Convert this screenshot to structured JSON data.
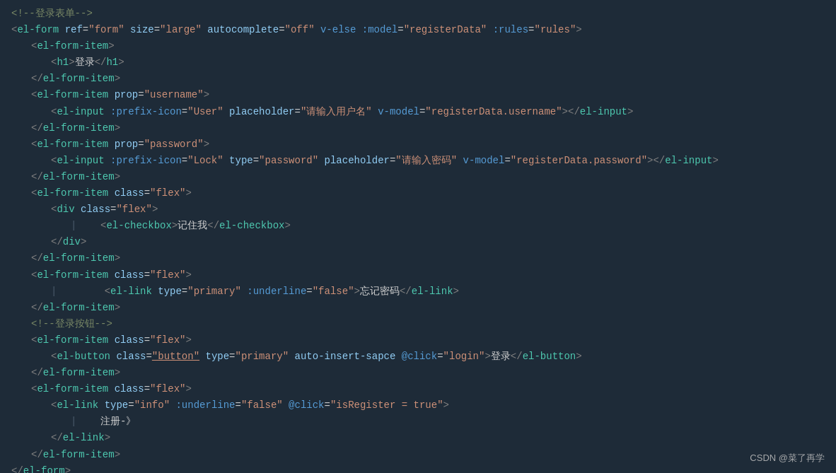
{
  "watermark": "CSDN @菜了再学",
  "lines": [
    {
      "indent": 0,
      "tokens": [
        {
          "t": "comment",
          "v": "<!--登录表单-->"
        }
      ]
    },
    {
      "indent": 0,
      "tokens": [
        {
          "t": "punct",
          "v": "<"
        },
        {
          "t": "tag",
          "v": "el-form"
        },
        {
          "t": "text",
          "v": " "
        },
        {
          "t": "attr",
          "v": "ref"
        },
        {
          "t": "eq",
          "v": "="
        },
        {
          "t": "str",
          "v": "\"form\""
        },
        {
          "t": "text",
          "v": " "
        },
        {
          "t": "attr",
          "v": "size"
        },
        {
          "t": "eq",
          "v": "="
        },
        {
          "t": "str",
          "v": "\"large\""
        },
        {
          "t": "text",
          "v": " "
        },
        {
          "t": "attr",
          "v": "autocomplete"
        },
        {
          "t": "eq",
          "v": "="
        },
        {
          "t": "str",
          "v": "\"off\""
        },
        {
          "t": "text",
          "v": " "
        },
        {
          "t": "bind",
          "v": "v-else"
        },
        {
          "t": "text",
          "v": " "
        },
        {
          "t": "bind",
          "v": ":model"
        },
        {
          "t": "eq",
          "v": "="
        },
        {
          "t": "str",
          "v": "\"registerData\""
        },
        {
          "t": "text",
          "v": " "
        },
        {
          "t": "bind",
          "v": ":rules"
        },
        {
          "t": "eq",
          "v": "="
        },
        {
          "t": "str",
          "v": "\"rules\""
        },
        {
          "t": "punct",
          "v": ">"
        }
      ]
    },
    {
      "indent": 1,
      "tokens": [
        {
          "t": "punct",
          "v": "<"
        },
        {
          "t": "tag",
          "v": "el-form-item"
        },
        {
          "t": "punct",
          "v": ">"
        }
      ]
    },
    {
      "indent": 2,
      "tokens": [
        {
          "t": "punct",
          "v": "<"
        },
        {
          "t": "tag",
          "v": "h1"
        },
        {
          "t": "punct",
          "v": ">"
        },
        {
          "t": "text-cn",
          "v": "登录"
        },
        {
          "t": "punct",
          "v": "</"
        },
        {
          "t": "tag",
          "v": "h1"
        },
        {
          "t": "punct",
          "v": ">"
        }
      ]
    },
    {
      "indent": 1,
      "tokens": [
        {
          "t": "punct",
          "v": "</"
        },
        {
          "t": "tag",
          "v": "el-form-item"
        },
        {
          "t": "punct",
          "v": ">"
        }
      ]
    },
    {
      "indent": 1,
      "tokens": [
        {
          "t": "punct",
          "v": "<"
        },
        {
          "t": "tag",
          "v": "el-form-item"
        },
        {
          "t": "text",
          "v": " "
        },
        {
          "t": "attr",
          "v": "prop"
        },
        {
          "t": "eq",
          "v": "="
        },
        {
          "t": "str-username",
          "v": "\"username\""
        },
        {
          "t": "punct",
          "v": ">"
        }
      ]
    },
    {
      "indent": 2,
      "tokens": [
        {
          "t": "punct",
          "v": "<"
        },
        {
          "t": "tag",
          "v": "el-input"
        },
        {
          "t": "text",
          "v": " "
        },
        {
          "t": "bind",
          "v": ":prefix-icon"
        },
        {
          "t": "eq",
          "v": "="
        },
        {
          "t": "str",
          "v": "\"User\""
        },
        {
          "t": "text",
          "v": " "
        },
        {
          "t": "attr",
          "v": "placeholder"
        },
        {
          "t": "eq",
          "v": "="
        },
        {
          "t": "str-cn",
          "v": "\"请输入用户名\""
        },
        {
          "t": "text",
          "v": " "
        },
        {
          "t": "bind",
          "v": "v-model"
        },
        {
          "t": "eq",
          "v": "="
        },
        {
          "t": "str",
          "v": "\"registerData.username\""
        },
        {
          "t": "punct",
          "v": "></"
        },
        {
          "t": "tag",
          "v": "el-input"
        },
        {
          "t": "punct",
          "v": ">"
        }
      ]
    },
    {
      "indent": 1,
      "tokens": [
        {
          "t": "punct",
          "v": "</"
        },
        {
          "t": "tag",
          "v": "el-form-item"
        },
        {
          "t": "punct",
          "v": ">"
        }
      ]
    },
    {
      "indent": 1,
      "tokens": [
        {
          "t": "punct",
          "v": "<"
        },
        {
          "t": "tag",
          "v": "el-form-item"
        },
        {
          "t": "text",
          "v": " "
        },
        {
          "t": "attr",
          "v": "prop"
        },
        {
          "t": "eq",
          "v": "="
        },
        {
          "t": "str",
          "v": "\"password\""
        },
        {
          "t": "punct",
          "v": ">"
        }
      ]
    },
    {
      "indent": 2,
      "tokens": [
        {
          "t": "punct",
          "v": "<"
        },
        {
          "t": "tag",
          "v": "el-input"
        },
        {
          "t": "text",
          "v": " "
        },
        {
          "t": "bind",
          "v": ":prefix-icon"
        },
        {
          "t": "eq",
          "v": "="
        },
        {
          "t": "str",
          "v": "\"Lock\""
        },
        {
          "t": "text",
          "v": " "
        },
        {
          "t": "attr",
          "v": "type"
        },
        {
          "t": "eq",
          "v": "="
        },
        {
          "t": "str",
          "v": "\"password\""
        },
        {
          "t": "text",
          "v": " "
        },
        {
          "t": "attr",
          "v": "placeholder"
        },
        {
          "t": "eq",
          "v": "="
        },
        {
          "t": "str-cn",
          "v": "\"请输入密码\""
        },
        {
          "t": "text",
          "v": " "
        },
        {
          "t": "bind",
          "v": "v-model"
        },
        {
          "t": "eq",
          "v": "="
        },
        {
          "t": "str",
          "v": "\"registerData.password\""
        },
        {
          "t": "punct",
          "v": "></"
        },
        {
          "t": "tag",
          "v": "el-input"
        },
        {
          "t": "punct",
          "v": ">"
        }
      ]
    },
    {
      "indent": 1,
      "tokens": [
        {
          "t": "punct",
          "v": "</"
        },
        {
          "t": "tag",
          "v": "el-form-item"
        },
        {
          "t": "punct",
          "v": ">"
        }
      ]
    },
    {
      "indent": 1,
      "tokens": [
        {
          "t": "punct",
          "v": "<"
        },
        {
          "t": "tag",
          "v": "el-form-item"
        },
        {
          "t": "text",
          "v": " "
        },
        {
          "t": "attr",
          "v": "class"
        },
        {
          "t": "eq",
          "v": "="
        },
        {
          "t": "str-flex",
          "v": "\"flex\""
        },
        {
          "t": "punct",
          "v": ">"
        }
      ]
    },
    {
      "indent": 2,
      "tokens": [
        {
          "t": "punct",
          "v": "<"
        },
        {
          "t": "tag",
          "v": "div"
        },
        {
          "t": "text",
          "v": " "
        },
        {
          "t": "attr",
          "v": "class"
        },
        {
          "t": "eq",
          "v": "="
        },
        {
          "t": "str-flex",
          "v": "\"flex\""
        },
        {
          "t": "punct",
          "v": ">"
        }
      ]
    },
    {
      "indent": 3,
      "tokens": [
        {
          "t": "pipe",
          "v": "|    "
        },
        {
          "t": "punct",
          "v": "<"
        },
        {
          "t": "tag",
          "v": "el-checkbox"
        },
        {
          "t": "punct",
          "v": ">"
        },
        {
          "t": "text-cn",
          "v": "记住我"
        },
        {
          "t": "punct",
          "v": "</"
        },
        {
          "t": "tag",
          "v": "el-checkbox"
        },
        {
          "t": "punct",
          "v": ">"
        }
      ]
    },
    {
      "indent": 2,
      "tokens": [
        {
          "t": "punct",
          "v": "</"
        },
        {
          "t": "tag",
          "v": "div"
        },
        {
          "t": "punct",
          "v": ">"
        }
      ]
    },
    {
      "indent": 1,
      "tokens": [
        {
          "t": "punct",
          "v": "</"
        },
        {
          "t": "tag",
          "v": "el-form-item"
        },
        {
          "t": "punct",
          "v": ">"
        }
      ]
    },
    {
      "indent": 1,
      "tokens": [
        {
          "t": "punct",
          "v": "<"
        },
        {
          "t": "tag",
          "v": "el-form-item"
        },
        {
          "t": "text",
          "v": " "
        },
        {
          "t": "attr",
          "v": "class"
        },
        {
          "t": "eq",
          "v": "="
        },
        {
          "t": "str-flex",
          "v": "\"flex\""
        },
        {
          "t": "punct",
          "v": ">"
        }
      ]
    },
    {
      "indent": 2,
      "tokens": [
        {
          "t": "pipe",
          "v": "|    "
        },
        {
          "t": "pipe",
          "v": "    "
        },
        {
          "t": "punct",
          "v": "<"
        },
        {
          "t": "tag",
          "v": "el-link"
        },
        {
          "t": "text",
          "v": " "
        },
        {
          "t": "attr",
          "v": "type"
        },
        {
          "t": "eq",
          "v": "="
        },
        {
          "t": "str-link",
          "v": "\"primary\""
        },
        {
          "t": "text",
          "v": " "
        },
        {
          "t": "bind",
          "v": ":underline"
        },
        {
          "t": "eq",
          "v": "="
        },
        {
          "t": "str",
          "v": "\"false\""
        },
        {
          "t": "punct",
          "v": ">"
        },
        {
          "t": "text-cn",
          "v": "忘记密码"
        },
        {
          "t": "punct",
          "v": "</"
        },
        {
          "t": "tag",
          "v": "el-link"
        },
        {
          "t": "punct",
          "v": ">"
        }
      ]
    },
    {
      "indent": 1,
      "tokens": [
        {
          "t": "punct",
          "v": "</"
        },
        {
          "t": "tag",
          "v": "el-form-item"
        },
        {
          "t": "punct",
          "v": ">"
        }
      ]
    },
    {
      "indent": 1,
      "tokens": [
        {
          "t": "comment",
          "v": "<!--登录按钮-->"
        }
      ]
    },
    {
      "indent": 1,
      "tokens": [
        {
          "t": "punct",
          "v": "<"
        },
        {
          "t": "tag",
          "v": "el-form-item"
        },
        {
          "t": "text",
          "v": " "
        },
        {
          "t": "attr",
          "v": "class"
        },
        {
          "t": "eq",
          "v": "="
        },
        {
          "t": "str-flex",
          "v": "\"flex\""
        },
        {
          "t": "punct",
          "v": ">"
        }
      ]
    },
    {
      "indent": 2,
      "tokens": [
        {
          "t": "punct",
          "v": "<"
        },
        {
          "t": "tag",
          "v": "el-button"
        },
        {
          "t": "text",
          "v": " "
        },
        {
          "t": "attr",
          "v": "class"
        },
        {
          "t": "eq",
          "v": "="
        },
        {
          "t": "str-underline",
          "v": "\"button\""
        },
        {
          "t": "text",
          "v": " "
        },
        {
          "t": "attr",
          "v": "type"
        },
        {
          "t": "eq",
          "v": "="
        },
        {
          "t": "str-link",
          "v": "\"primary\""
        },
        {
          "t": "text",
          "v": " "
        },
        {
          "t": "attr",
          "v": "auto-insert-sapce"
        },
        {
          "t": "text",
          "v": " "
        },
        {
          "t": "bind",
          "v": "@click"
        },
        {
          "t": "eq",
          "v": "="
        },
        {
          "t": "str",
          "v": "\"login\""
        },
        {
          "t": "punct",
          "v": ">"
        },
        {
          "t": "text-cn",
          "v": "登录"
        },
        {
          "t": "punct",
          "v": "</"
        },
        {
          "t": "tag",
          "v": "el-button"
        },
        {
          "t": "punct",
          "v": ">"
        }
      ]
    },
    {
      "indent": 1,
      "tokens": [
        {
          "t": "punct",
          "v": "</"
        },
        {
          "t": "tag",
          "v": "el-form-item"
        },
        {
          "t": "punct",
          "v": ">"
        }
      ]
    },
    {
      "indent": 1,
      "tokens": [
        {
          "t": "punct",
          "v": "<"
        },
        {
          "t": "tag",
          "v": "el-form-item"
        },
        {
          "t": "text",
          "v": " "
        },
        {
          "t": "attr",
          "v": "class"
        },
        {
          "t": "eq",
          "v": "="
        },
        {
          "t": "str-flex",
          "v": "\"flex\""
        },
        {
          "t": "punct",
          "v": ">"
        }
      ]
    },
    {
      "indent": 2,
      "tokens": [
        {
          "t": "punct",
          "v": "<"
        },
        {
          "t": "tag",
          "v": "el-link"
        },
        {
          "t": "text",
          "v": " "
        },
        {
          "t": "attr",
          "v": "type"
        },
        {
          "t": "eq",
          "v": "="
        },
        {
          "t": "str-link-info",
          "v": "\"info\""
        },
        {
          "t": "text",
          "v": " "
        },
        {
          "t": "bind",
          "v": ":underline"
        },
        {
          "t": "eq",
          "v": "="
        },
        {
          "t": "str",
          "v": "\"false\""
        },
        {
          "t": "text",
          "v": " "
        },
        {
          "t": "bind",
          "v": "@click"
        },
        {
          "t": "eq",
          "v": "="
        },
        {
          "t": "str",
          "v": "\"isRegister = true\""
        },
        {
          "t": "punct",
          "v": ">"
        }
      ]
    },
    {
      "indent": 3,
      "tokens": [
        {
          "t": "pipe",
          "v": "|    "
        },
        {
          "t": "text-cn",
          "v": "注册-》"
        }
      ]
    },
    {
      "indent": 2,
      "tokens": [
        {
          "t": "punct",
          "v": "</"
        },
        {
          "t": "tag",
          "v": "el-link"
        },
        {
          "t": "punct",
          "v": ">"
        }
      ]
    },
    {
      "indent": 1,
      "tokens": [
        {
          "t": "punct",
          "v": "</"
        },
        {
          "t": "tag",
          "v": "el-form-item"
        },
        {
          "t": "punct",
          "v": ">"
        }
      ]
    },
    {
      "indent": 0,
      "tokens": [
        {
          "t": "punct",
          "v": "</"
        },
        {
          "t": "tag",
          "v": "el-form"
        },
        {
          "t": "punct",
          "v": ">"
        }
      ]
    }
  ]
}
